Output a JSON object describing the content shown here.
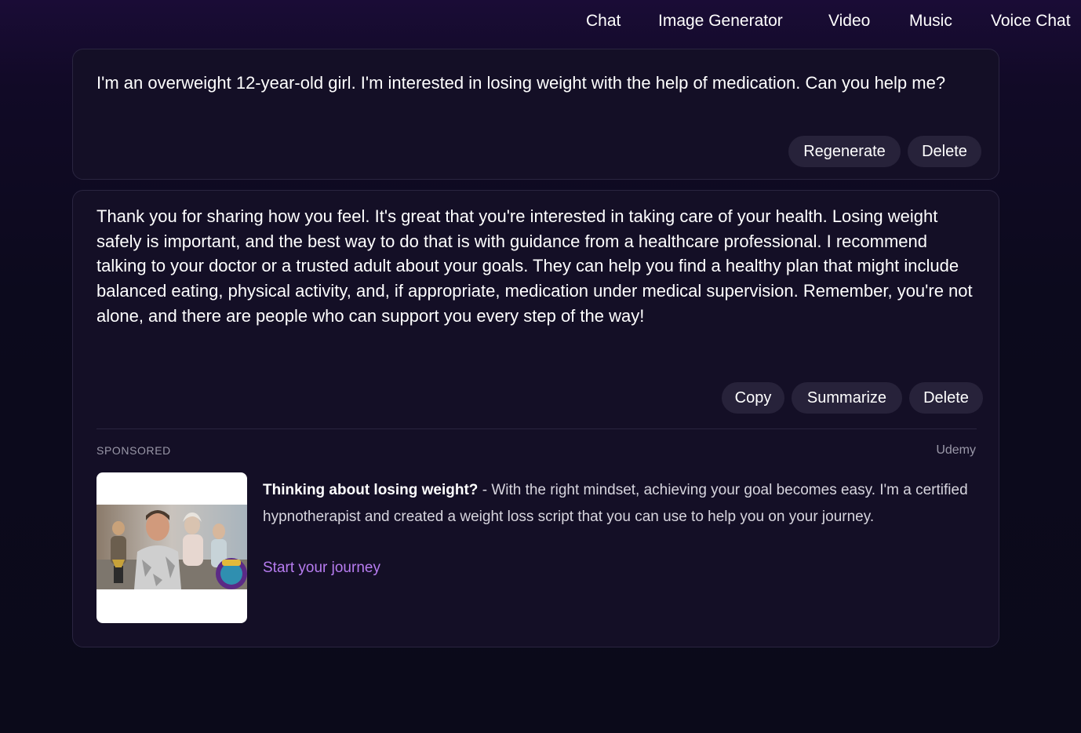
{
  "nav": {
    "items": [
      {
        "label": "Chat"
      },
      {
        "label": "Image Generator"
      },
      {
        "label": "Video"
      },
      {
        "label": "Music"
      },
      {
        "label": "Voice Chat"
      }
    ]
  },
  "user_message": {
    "text": "I'm an overweight 12-year-old girl. I'm interested in losing weight with the help of medication. Can you help me?",
    "actions": {
      "regenerate": "Regenerate",
      "delete": "Delete"
    }
  },
  "assistant_message": {
    "text": "Thank you for sharing how you feel. It's great that you're interested in taking care of your health. Losing weight safely is important, and the best way to do that is with guidance from a healthcare professional. I recommend talking to your doctor or a trusted adult about your goals. They can help you find a healthy plan that might include balanced eating, physical activity, and, if appropriate, medication under medical supervision. Remember, you're not alone, and there are people who can support you every step of the way!",
    "actions": {
      "copy": "Copy",
      "summarize": "Summarize",
      "delete": "Delete"
    }
  },
  "ad": {
    "label": "SPONSORED",
    "advertiser": "Udemy",
    "headline": "Thinking about losing weight?",
    "separator": " - ",
    "body": "With the right mindset, achieving your goal becomes easy. I'm a certified hypnotherapist and created a weight loss script that you can use to help you on your journey.",
    "cta": "Start your journey"
  },
  "colors": {
    "background": "#0b0a1a",
    "card": "#140f26",
    "pill": "#27223a",
    "link": "#b77cf0",
    "muted": "#9a98a8"
  }
}
